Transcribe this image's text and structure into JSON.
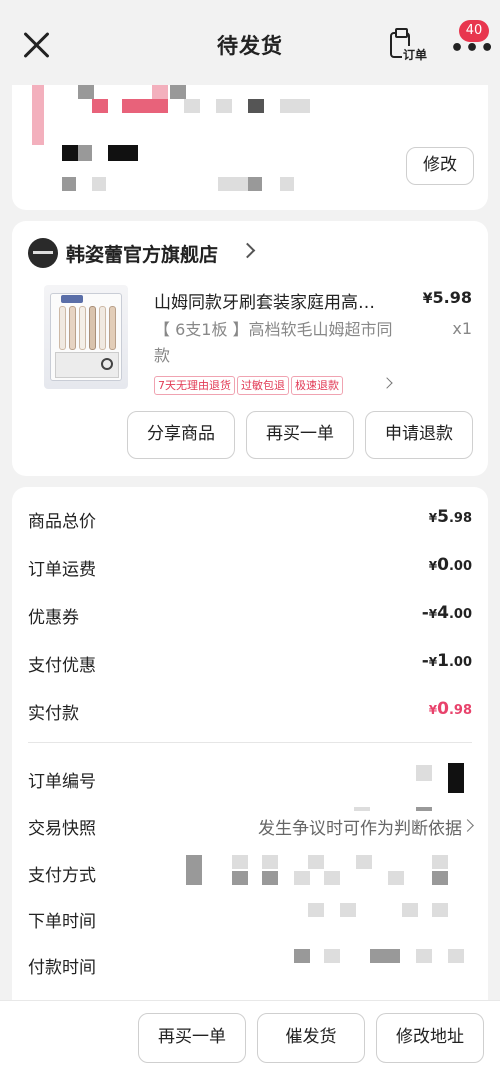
{
  "header": {
    "title": "待发货",
    "orders_label": "订单",
    "badge_count": "40"
  },
  "address": {
    "modify_label": "修改"
  },
  "shop": {
    "name": "韩姿蕾官方旗舰店"
  },
  "product": {
    "title": "山姆同款牙刷套装家庭用高…",
    "price_currency": "¥",
    "price_value": "5.98",
    "spec": "【 6支1板 】高档软毛山姆超市同款",
    "quantity": "x1",
    "tags": [
      "7天无理由退货",
      "过敏包退",
      "极速退款"
    ]
  },
  "item_actions": {
    "share": "分享商品",
    "rebuy": "再买一单",
    "refund": "申请退款"
  },
  "summary": {
    "rows": [
      {
        "label": "商品总价",
        "prefix": "",
        "currency": "¥",
        "int": "5",
        "dec": ".98"
      },
      {
        "label": "订单运费",
        "prefix": "",
        "currency": "¥",
        "int": "0",
        "dec": ".00"
      },
      {
        "label": "优惠券",
        "prefix": "-",
        "currency": "¥",
        "int": "4",
        "dec": ".00"
      },
      {
        "label": "支付优惠",
        "prefix": "-",
        "currency": "¥",
        "int": "1",
        "dec": ".00"
      },
      {
        "label": "实付款",
        "prefix": "",
        "currency": "¥",
        "int": "0",
        "dec": ".98"
      }
    ],
    "accent_color": "#e8426b"
  },
  "order_info": {
    "order_number_label": "订单编号",
    "snapshot_label": "交易快照",
    "snapshot_link": "发生争议时可作为判断依据",
    "payment_method_label": "支付方式",
    "order_time_label": "下单时间",
    "pay_time_label": "付款时间"
  },
  "bottom_bar": {
    "rebuy": "再买一单",
    "urge": "催发货",
    "change_address": "修改地址"
  }
}
